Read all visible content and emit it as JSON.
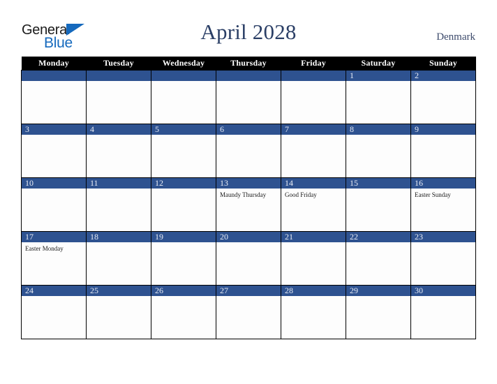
{
  "brand": {
    "name_part1": "General",
    "name_part2": "Blue",
    "triangle_icon": "triangle-icon",
    "accent_color": "#1569bd",
    "text_color": "#1b1b1b"
  },
  "header": {
    "title": "April 2028",
    "country": "Denmark",
    "title_color": "#2b3f66"
  },
  "calendar": {
    "weekday_headers": [
      "Monday",
      "Tuesday",
      "Wednesday",
      "Thursday",
      "Friday",
      "Saturday",
      "Sunday"
    ],
    "header_bg": "#000000",
    "daynum_bg": "#2e5290",
    "daynum_color": "#e8ecf5",
    "weeks": [
      [
        {
          "day": "",
          "event": ""
        },
        {
          "day": "",
          "event": ""
        },
        {
          "day": "",
          "event": ""
        },
        {
          "day": "",
          "event": ""
        },
        {
          "day": "",
          "event": ""
        },
        {
          "day": "1",
          "event": ""
        },
        {
          "day": "2",
          "event": ""
        }
      ],
      [
        {
          "day": "3",
          "event": ""
        },
        {
          "day": "4",
          "event": ""
        },
        {
          "day": "5",
          "event": ""
        },
        {
          "day": "6",
          "event": ""
        },
        {
          "day": "7",
          "event": ""
        },
        {
          "day": "8",
          "event": ""
        },
        {
          "day": "9",
          "event": ""
        }
      ],
      [
        {
          "day": "10",
          "event": ""
        },
        {
          "day": "11",
          "event": ""
        },
        {
          "day": "12",
          "event": ""
        },
        {
          "day": "13",
          "event": "Maundy Thursday"
        },
        {
          "day": "14",
          "event": "Good Friday"
        },
        {
          "day": "15",
          "event": ""
        },
        {
          "day": "16",
          "event": "Easter Sunday"
        }
      ],
      [
        {
          "day": "17",
          "event": "Easter Monday"
        },
        {
          "day": "18",
          "event": ""
        },
        {
          "day": "19",
          "event": ""
        },
        {
          "day": "20",
          "event": ""
        },
        {
          "day": "21",
          "event": ""
        },
        {
          "day": "22",
          "event": ""
        },
        {
          "day": "23",
          "event": ""
        }
      ],
      [
        {
          "day": "24",
          "event": ""
        },
        {
          "day": "25",
          "event": ""
        },
        {
          "day": "26",
          "event": ""
        },
        {
          "day": "27",
          "event": ""
        },
        {
          "day": "28",
          "event": ""
        },
        {
          "day": "29",
          "event": ""
        },
        {
          "day": "30",
          "event": ""
        }
      ]
    ]
  }
}
